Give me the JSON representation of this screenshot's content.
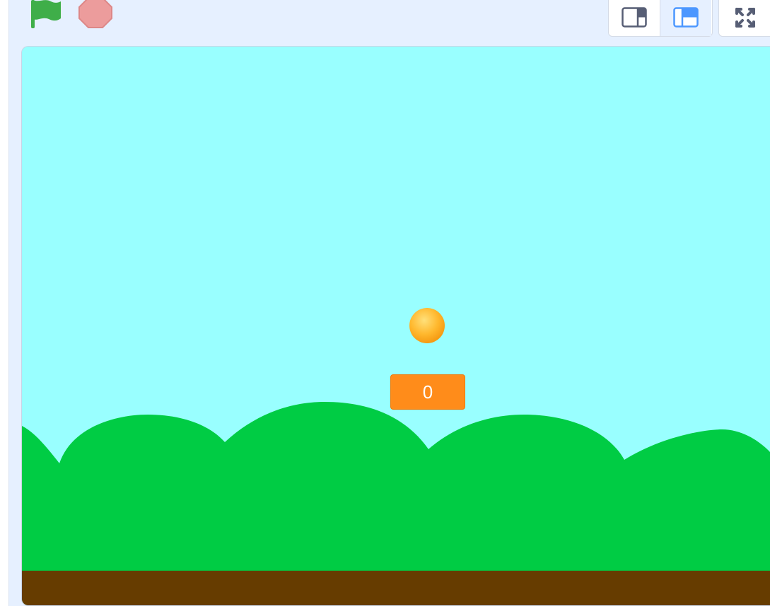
{
  "toolbar": {
    "green_flag_icon": "green-flag-icon",
    "stop_icon": "stop-sign-icon",
    "small_stage_icon": "small-stage-icon",
    "normal_stage_icon": "normal-stage-icon",
    "fullscreen_icon": "fullscreen-icon"
  },
  "stage": {
    "score_value": "0",
    "colors": {
      "sky": "#99ffff",
      "hills": "#00cc44",
      "ground": "#663c00",
      "ball": "#ffb82e",
      "monitor": "#ff8c1a",
      "flag": "#3fae49",
      "stop": "#ec9c9c",
      "accent": "#4c97ff"
    }
  }
}
